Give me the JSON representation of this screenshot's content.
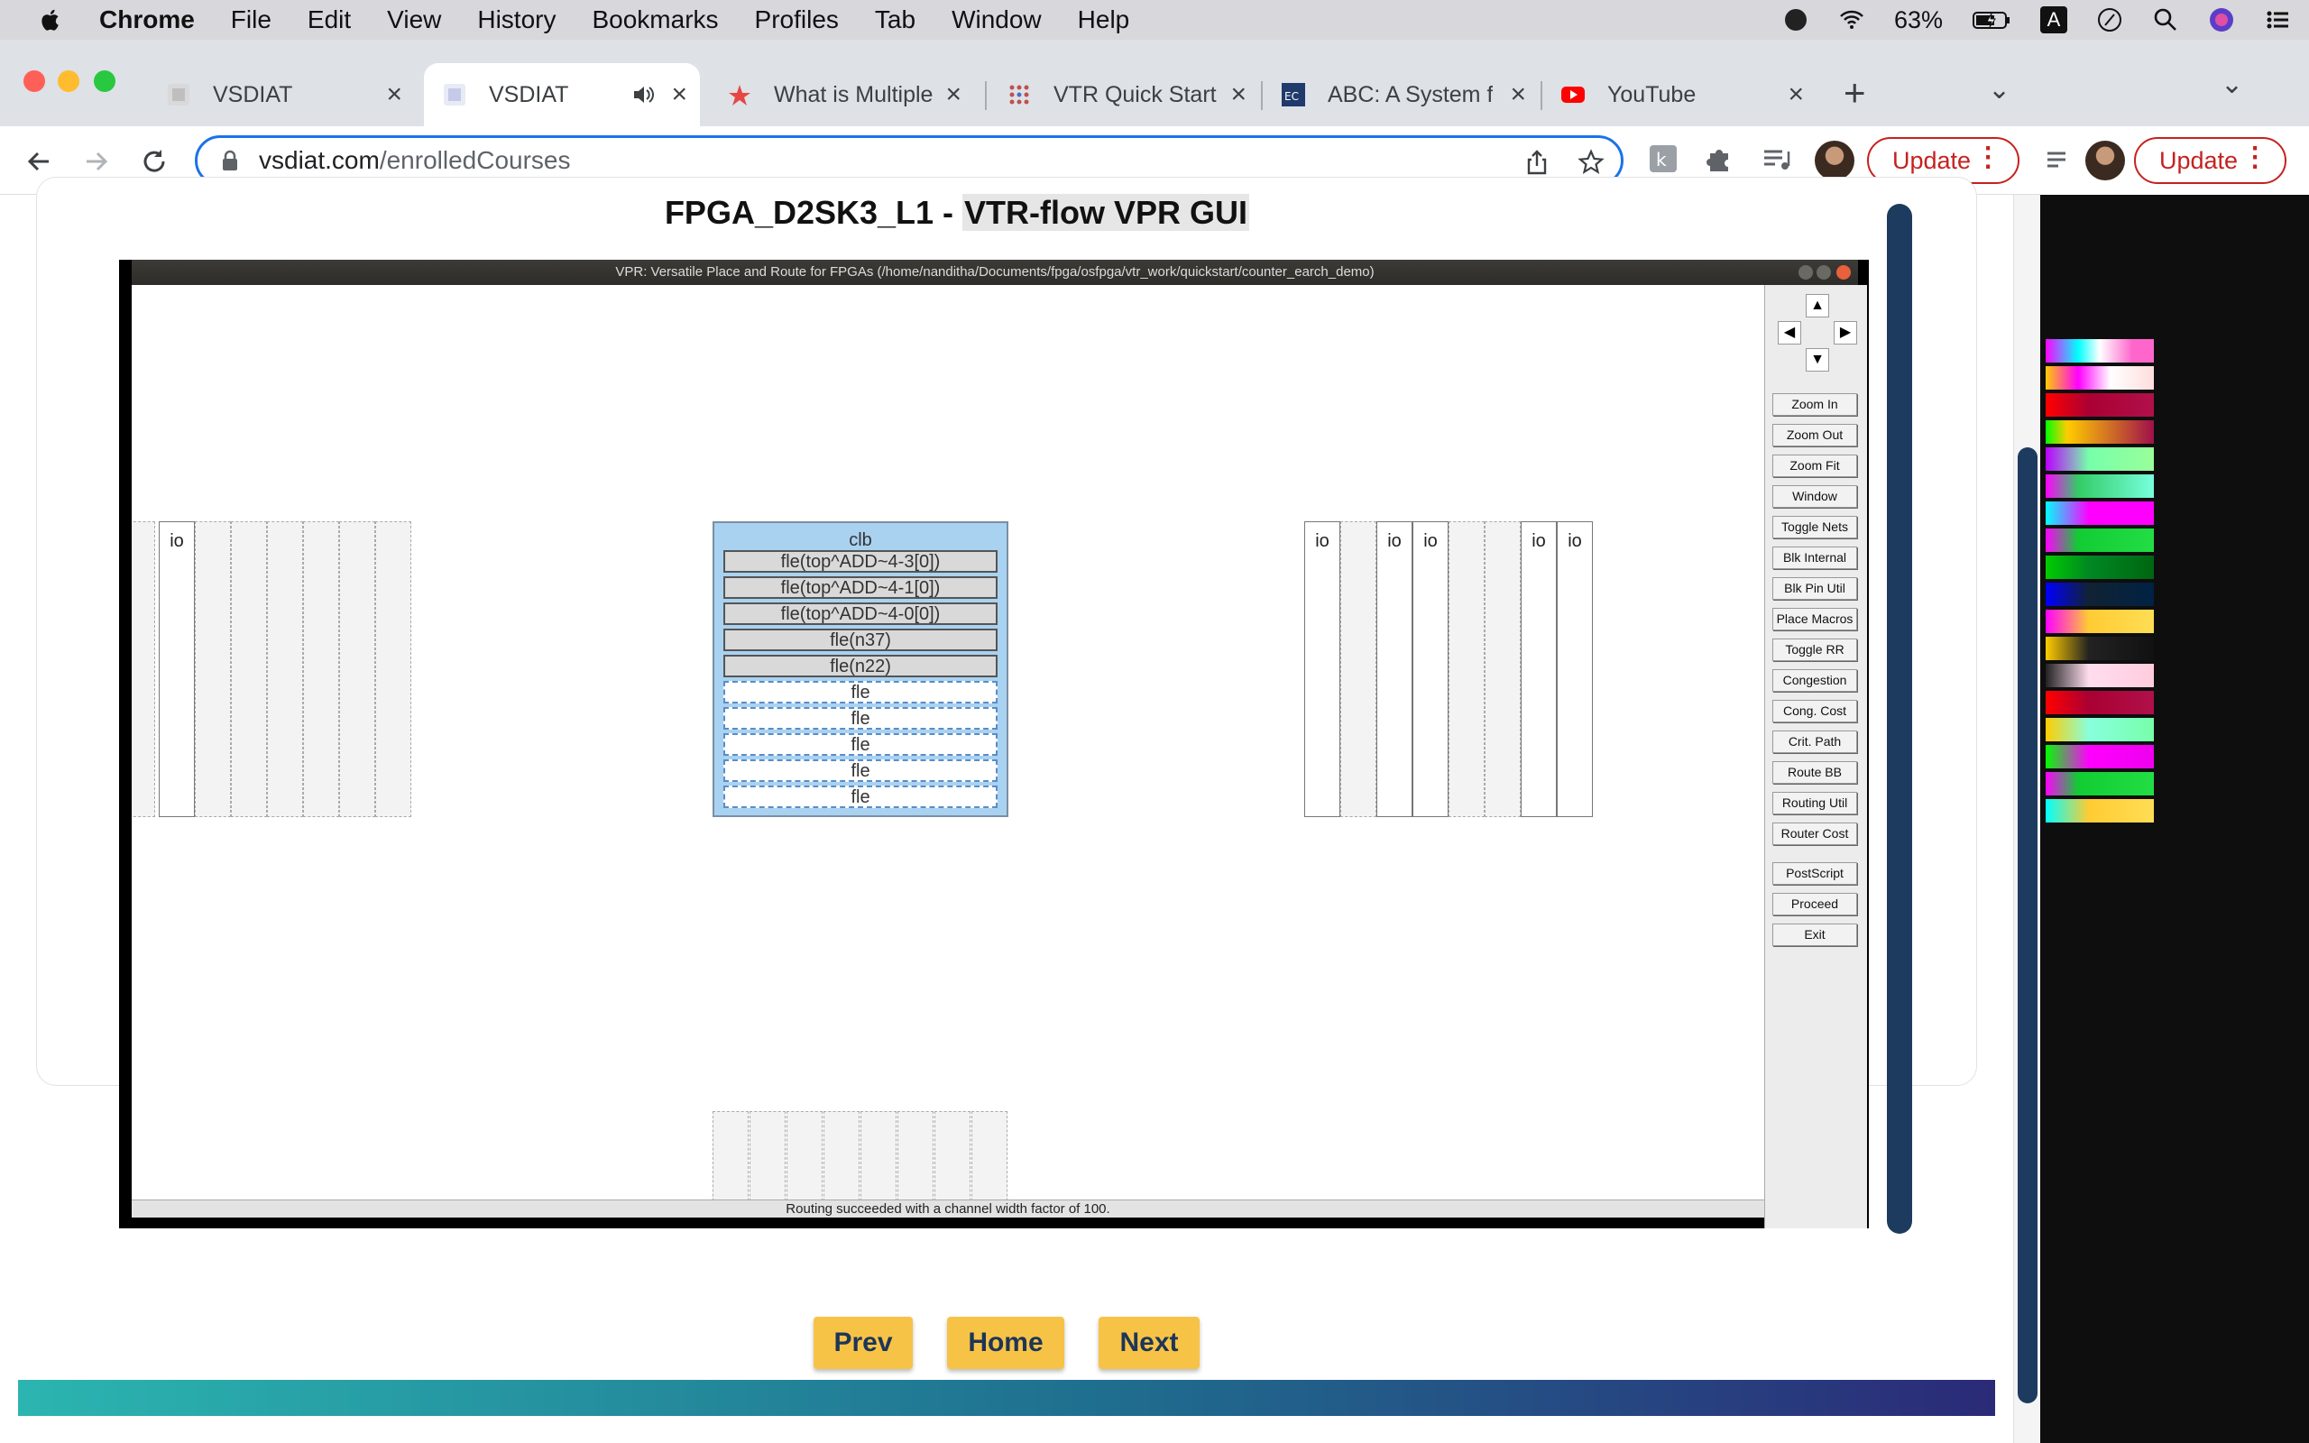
{
  "menubar": {
    "app": "Chrome",
    "items": [
      "File",
      "Edit",
      "View",
      "History",
      "Bookmarks",
      "Profiles",
      "Tab",
      "Window",
      "Help"
    ],
    "battery": "63%",
    "keyboard_indicator": "A"
  },
  "browser": {
    "tabs": [
      {
        "title": "VSDIAT",
        "favicon": "vsd-icon"
      },
      {
        "title": "VSDIAT",
        "favicon": "vsd-icon",
        "active": true
      },
      {
        "title": "What is Multiple",
        "favicon": "star-logo-icon"
      },
      {
        "title": "VTR Quick Start",
        "favicon": "dots-grid-icon"
      },
      {
        "title": "ABC: A System f",
        "favicon": "ecs-logo-icon"
      },
      {
        "title": "YouTube",
        "favicon": "youtube-icon"
      }
    ],
    "url_host": "vsdiat.com",
    "url_path": "/enrolledCourses",
    "update_label": "Update",
    "update_label_secondary": "Update"
  },
  "page": {
    "title_prefix": "FPGA_D2SK3_L1 - ",
    "title_highlight": "VTR-flow VPR GUI",
    "nav": {
      "prev": "Prev",
      "home": "Home",
      "next": "Next"
    }
  },
  "vpr": {
    "window_title": "VPR: Versatile Place and Route for FPGAs (/home/nanditha/Documents/fpga/osfpga/vtr_work/quickstart/counter_earch_demo)",
    "status": "Routing succeeded with a channel width factor of 100.",
    "buttons": [
      "Zoom In",
      "Zoom Out",
      "Zoom Fit",
      "Window",
      "Toggle Nets",
      "Blk Internal",
      "Blk Pin Util",
      "Place Macros",
      "Toggle RR",
      "Congestion",
      "Cong. Cost",
      "Crit. Path",
      "Route BB",
      "Routing Util",
      "Router Cost",
      "PostScript",
      "Proceed",
      "Exit"
    ],
    "arrows": {
      "up": "▲",
      "down": "▼",
      "left": "◀",
      "right": "▶"
    },
    "io_label": "io",
    "clb": {
      "label": "clb",
      "fles": [
        "fle(top^ADD~4-3[0])",
        "fle(top^ADD~4-1[0])",
        "fle(top^ADD~4-0[0])",
        "fle(n37)",
        "fle(n22)",
        "fle",
        "fle",
        "fle",
        "fle",
        "fle"
      ]
    }
  },
  "colors": {
    "accent_blue": "#1a73e8",
    "nav_button": "#f7c347",
    "nav_text": "#1d3557",
    "clb_fill": "#a9d2f1",
    "scroll_thumb": "#1d3b5f"
  }
}
